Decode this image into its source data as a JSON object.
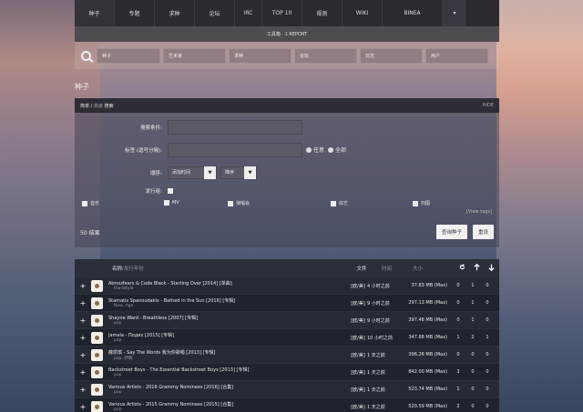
{
  "nav": [
    "种子",
    "专题",
    "求种",
    "论坛",
    "IRC",
    "TOP 10",
    "规则",
    "WIKI",
    "BINEA"
  ],
  "nav_more": "▾",
  "toolbar": "工具箱 · 1 REPORT",
  "search_boxes": [
    "种子",
    "艺术家",
    "求种",
    "论坛",
    "日志",
    "用户"
  ],
  "page_title": "种子",
  "panel": {
    "mode_simple": "简单",
    "mode_sep": " / ",
    "mode_adv": "高级",
    "mode_suffix": " 搜索",
    "hide": "HIDE"
  },
  "form": {
    "search_label": "搜索条件:",
    "tags_label": "标签 (逗号分隔):",
    "radio_any": "任意",
    "radio_all": "全部",
    "order_label": "顺序:",
    "order_value": "添加时间",
    "order_dir": "降序",
    "group_label": "发行组:"
  },
  "categories": [
    "音乐",
    "MV",
    "演唱会",
    "综艺",
    "扫图"
  ],
  "view_tags": "[View tags]",
  "results_count": "50 结果",
  "btn_search": "查询种子",
  "btn_reset": "重设",
  "table_head": {
    "name": "名称",
    "year": "/发行年份",
    "files": "文件",
    "time": "时间",
    "size": "大小"
  },
  "rows": [
    {
      "title": "Atmozfears & Code Black - Starting Over [2014] [单曲]",
      "tag": "Hardstyle",
      "files": "[欧/美]",
      "time": "4 小时之前",
      "size": "37.83 MB (Max)",
      "s": "0",
      "l": "1",
      "c": "0"
    },
    {
      "title": "Stamatis Spanoudakis - Bathed in the Sun [2016] [专辑]",
      "tag": "New, Age",
      "files": "[欧/美]",
      "time": "9 小时之前",
      "size": "297.13 MB (Max)",
      "s": "0",
      "l": "1",
      "c": "0"
    },
    {
      "title": "Shayne Ward - Breathless [2007] [专辑]",
      "tag": "pop",
      "files": "[欧/美]",
      "time": "9 小时之前",
      "size": "397.46 MB (Max)",
      "s": "0",
      "l": "1",
      "c": "0"
    },
    {
      "title": "Jamala - Подих [2015] [专辑]",
      "tag": "pop",
      "files": "[欧/美]",
      "time": "10 小时之前",
      "size": "347.88 MB (Max)",
      "s": "1",
      "l": "2",
      "c": "1"
    },
    {
      "title": "薛凯琪 - Say The Words 我为你歌唱 [2013] [专辑]",
      "tag": "pop, 抒情",
      "files": "[欧/美]",
      "time": "1 天之前",
      "size": "396.26 MB (Max)",
      "s": "0",
      "l": "0",
      "c": "0"
    },
    {
      "title": "Backstreet Boys - The Essential Backstreet Boys [2013] [专辑]",
      "tag": "pop",
      "files": "[欧/美]",
      "time": "1 天之前",
      "size": "842.00 MB (Max)",
      "s": "3",
      "l": "0",
      "c": "0"
    },
    {
      "title": "Various Artists - 2016 Grammy Nominees [2016] [合集]",
      "tag": "pop",
      "files": "[欧/美]",
      "time": "1 天之前",
      "size": "523.74 MB (Max)",
      "s": "1",
      "l": "0",
      "c": "0"
    },
    {
      "title": "Various Artists - 2015 Grammy Nominees [2015] [合集]",
      "tag": "pop",
      "files": "[欧/美]",
      "time": "1 天之前",
      "size": "520.59 MB (Max)",
      "s": "2",
      "l": "0",
      "c": "0"
    }
  ],
  "icons": {
    "refresh": "refresh-icon",
    "seed": "arrow-up-icon",
    "leech": "arrow-down-icon"
  }
}
